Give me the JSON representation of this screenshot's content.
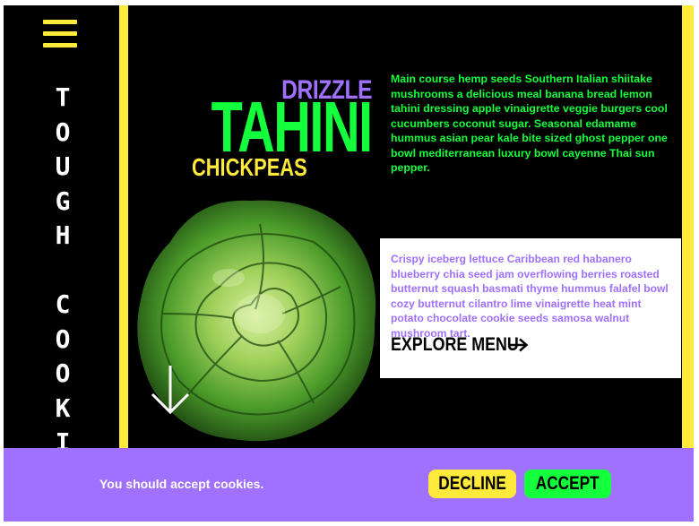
{
  "sidebar": {
    "menu_icon": "hamburger-menu-icon",
    "title_letters": [
      "T",
      "O",
      "U",
      "G",
      "H",
      " ",
      "C",
      "O",
      "O",
      "K",
      "I"
    ]
  },
  "hero": {
    "drizzle": "DRIZZLE",
    "tahini": "TAHINI",
    "chickpeas": "CHICKPEAS",
    "intro": "Main course hemp seeds Southern Italian shiitake mushrooms a delicious meal banana bread lemon tahini dressing apple vinaigrette veggie burgers cool cucumbers coconut sugar. Seasonal edamame hummus asian pear kale bite sized ghost pepper one bowl mediterranean luxury bowl cayenne Thai sun pepper.",
    "scroll_icon": "arrow-down-icon"
  },
  "card": {
    "text": "Crispy iceberg lettuce Caribbean red habanero blueberry chia seed jam overflowing berries roasted butternut squash basmati thyme hummus falafel bowl cozy butternut cilantro lime vinaigrette heat mint potato chocolate cookie seeds samosa walnut mushroom tart.",
    "explore_label": "EXPLORE MENU",
    "explore_icon": "arrow-right-icon"
  },
  "cookie": {
    "message": "You should accept cookies.",
    "decline_label": "DECLINE",
    "accept_label": "ACCEPT"
  },
  "colors": {
    "yellow": "#ffe93b",
    "green": "#14ff3c",
    "purple": "#a070ff",
    "black": "#000000",
    "white": "#ffffff"
  }
}
